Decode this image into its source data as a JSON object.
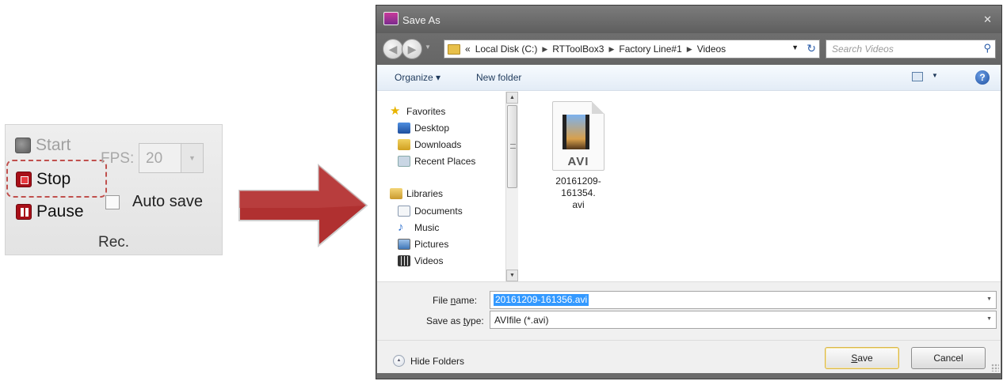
{
  "ribbon": {
    "start_label": "Start",
    "stop_label": "Stop",
    "pause_label": "Pause",
    "fps_label": "FPS:",
    "fps_value": "20",
    "autosave_label": "Auto save",
    "autosave_checked": false,
    "group_label": "Rec."
  },
  "arrow": {
    "color": "#b03030"
  },
  "dialog": {
    "title": "Save As",
    "close_symbol": "✕",
    "breadcrumb": [
      "Local Disk (C:)",
      "RTToolBox3",
      "Factory Line#1",
      "Videos"
    ],
    "breadcrumb_prefix": "«",
    "search_placeholder": "Search Videos",
    "toolbar": {
      "organize": "Organize ▾",
      "new_folder": "New folder"
    },
    "nav": {
      "favorites": "Favorites",
      "desktop": "Desktop",
      "downloads": "Downloads",
      "recent_places": "Recent Places",
      "libraries": "Libraries",
      "documents": "Documents",
      "music": "Music",
      "pictures": "Pictures",
      "videos": "Videos"
    },
    "file": {
      "ext_badge": "AVI",
      "name_line1": "20161209-161354.",
      "name_line2": "avi"
    },
    "file_name": {
      "label_pre": "File ",
      "label_u": "n",
      "label_post": "ame:",
      "value": "20161209-161356.avi"
    },
    "save_type": {
      "label_pre": "Save as ",
      "label_u": "t",
      "label_post": "ype:",
      "value": "AVIfile (*.avi)"
    },
    "hide_folders": "Hide Folders",
    "save_button": {
      "u": "S",
      "rest": "ave"
    },
    "cancel_button": "Cancel"
  }
}
